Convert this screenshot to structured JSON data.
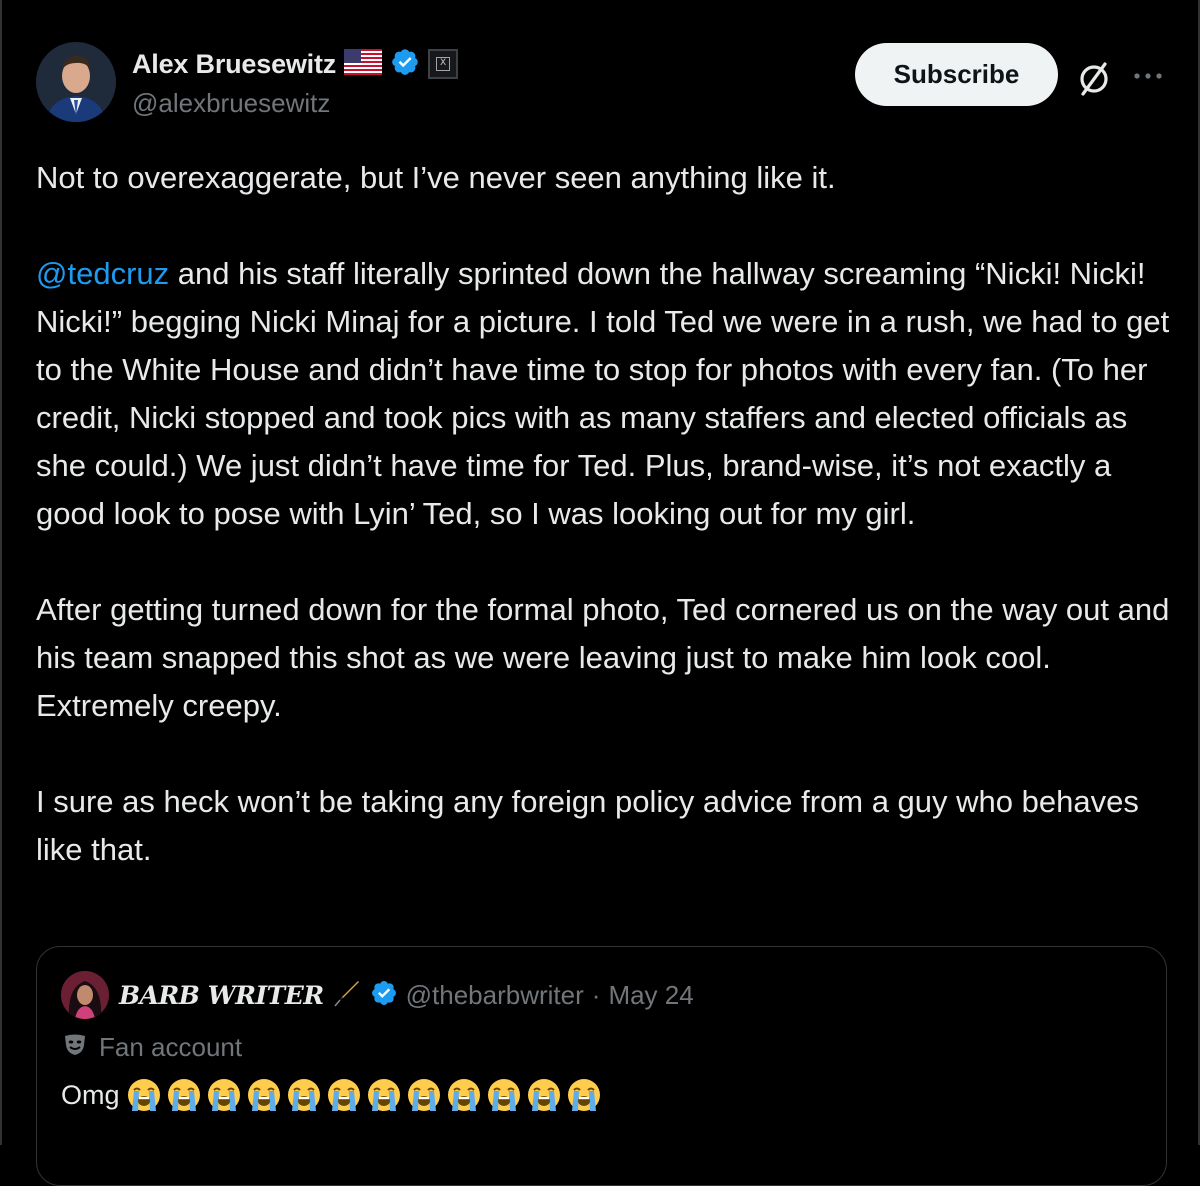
{
  "author": {
    "display_name": "Alex Bruesewitz",
    "handle": "@alexbruesewitz",
    "flag": "US flag",
    "verified": true
  },
  "header": {
    "subscribe_label": "Subscribe"
  },
  "tweet": {
    "line1": "Not to overexaggerate, but I’ve never seen anything like it.",
    "mention": "@tedcruz",
    "para2_rest": " and his staff literally sprinted down the hallway screaming “Nicki! Nicki! Nicki!” begging Nicki Minaj for a picture. I told Ted we were in a rush, we had to get to the White House and didn’t have time to stop for photos with every fan. (To her credit, Nicki stopped and took pics with as many staffers and elected officials as she could.) We just didn’t have time for Ted. Plus, brand-wise, it’s not exactly a good look to pose with Lyin’ Ted, so I was looking out for my girl.",
    "para3": "After getting turned down for the formal photo, Ted cornered us on the way out and his team snapped this shot as we were leaving just to make him look cool. Extremely creepy.",
    "para4": "I sure as heck won’t be taking any foreign policy advice from a guy who behaves like that."
  },
  "quote": {
    "display_name": "BARB WRITER",
    "handle": "@thebarbwriter",
    "separator": "·",
    "date": "May 24",
    "label": "Fan account",
    "text": "Omg",
    "emoji_count": 12
  },
  "colors": {
    "link": "#1d9bf0",
    "verified": "#1d9bf0",
    "muted": "#71767b"
  }
}
